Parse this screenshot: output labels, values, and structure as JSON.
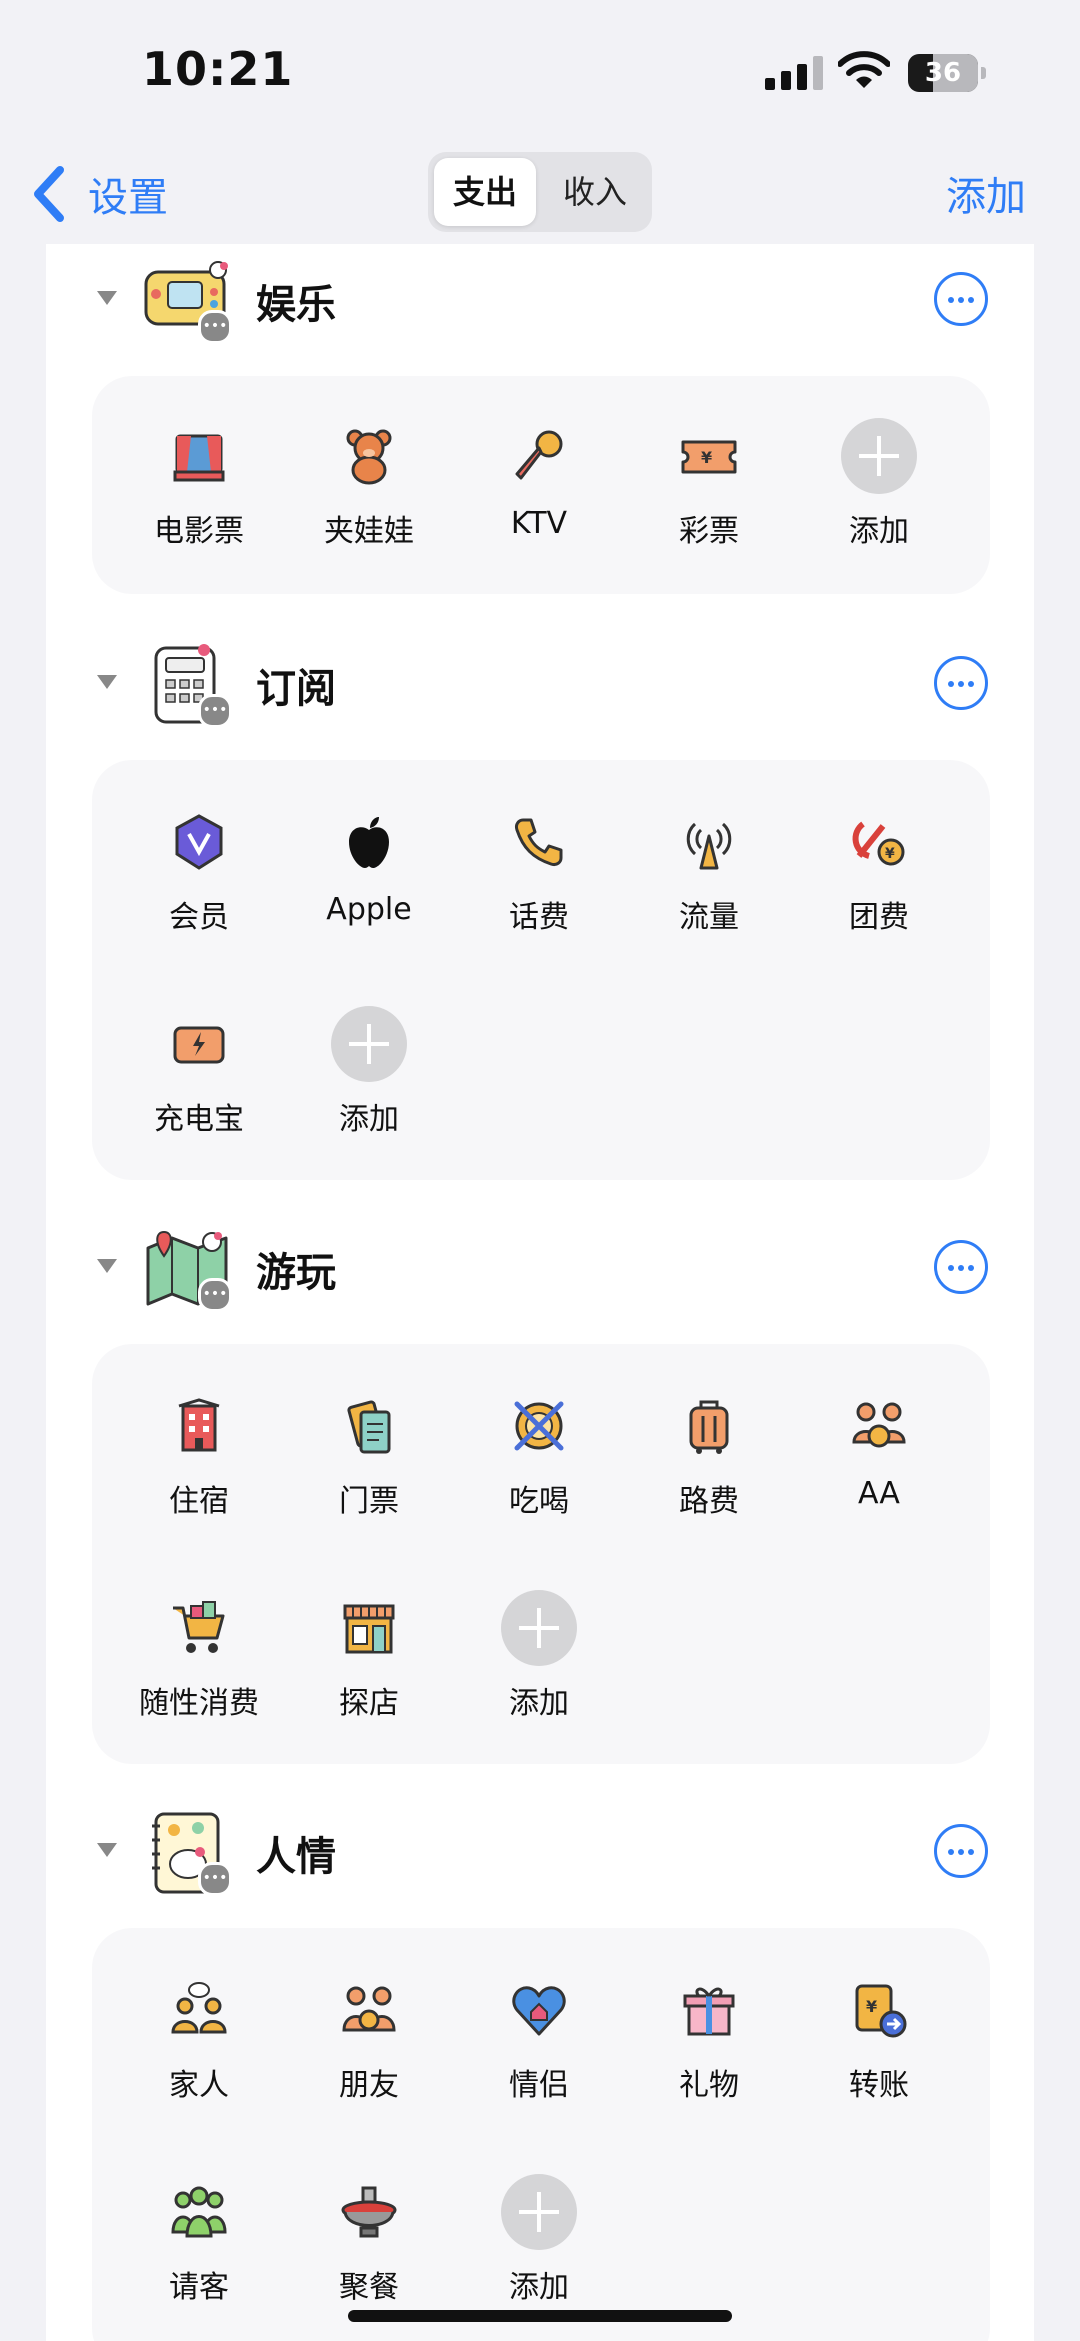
{
  "status": {
    "time": "10:21",
    "battery": "36",
    "battery_level": 0.36
  },
  "nav": {
    "back_label": "设置",
    "tabs": [
      "支出",
      "收入"
    ],
    "active_tab": "支出",
    "add_label": "添加"
  },
  "sections": [
    {
      "title": "娱乐",
      "items": [
        "电影票",
        "夹娃娃",
        "KTV",
        "彩票",
        "添加"
      ]
    },
    {
      "title": "订阅",
      "items": [
        "会员",
        "Apple",
        "话费",
        "流量",
        "团费",
        "充电宝",
        "添加"
      ]
    },
    {
      "title": "游玩",
      "items": [
        "住宿",
        "门票",
        "吃喝",
        "路费",
        "AA",
        "随性消费",
        "探店",
        "添加"
      ]
    },
    {
      "title": "人情",
      "items": [
        "家人",
        "朋友",
        "情侣",
        "礼物",
        "转账",
        "请客",
        "聚餐",
        "添加"
      ]
    }
  ],
  "accent_color": "#2f7df6"
}
